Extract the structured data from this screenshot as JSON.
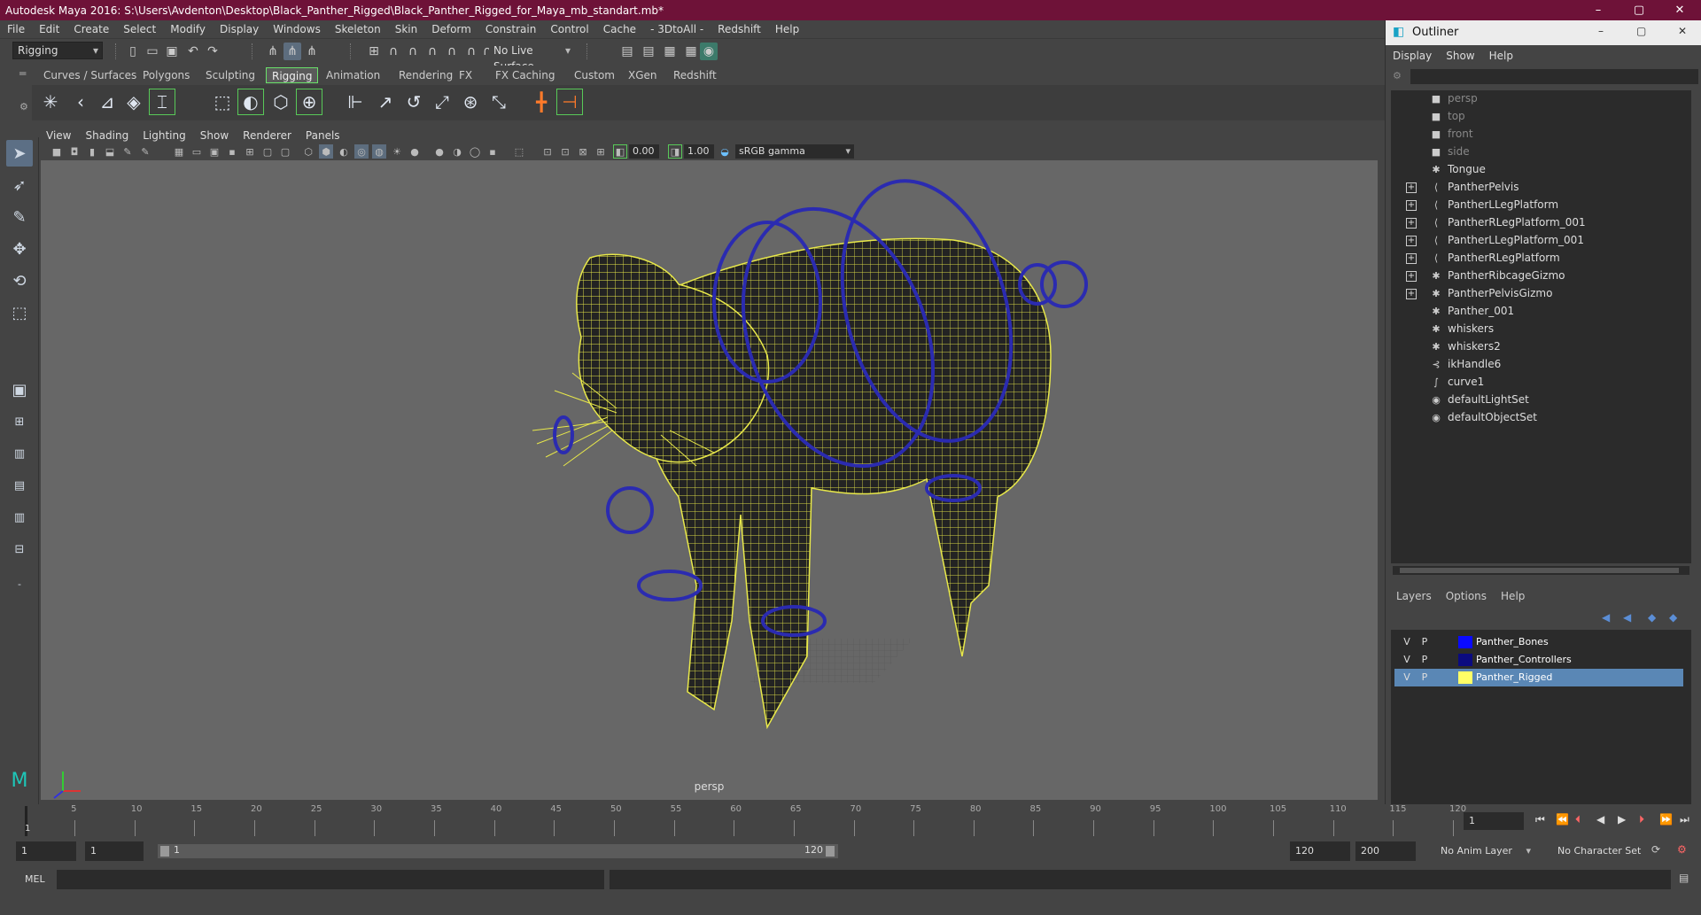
{
  "window": {
    "title": "Autodesk Maya 2016: S:\\Users\\Avdenton\\Desktop\\Black_Panther_Rigged\\Black_Panther_Rigged_for_Maya_mb_standart.mb*",
    "min": "–",
    "max": "▢",
    "close": "✕"
  },
  "menubar": [
    "File",
    "Edit",
    "Create",
    "Select",
    "Modify",
    "Display",
    "Windows",
    "Skeleton",
    "Skin",
    "Deform",
    "Constrain",
    "Control",
    "Cache",
    "- 3DtoAll -",
    "Redshift",
    "Help"
  ],
  "statusline": {
    "menuset": "Rigging",
    "live_surface": "No Live Surface"
  },
  "shelf_tabs": [
    "Curves / Surfaces",
    "Polygons",
    "Sculpting",
    "Rigging",
    "Animation",
    "Rendering",
    "FX",
    "FX Caching",
    "Custom",
    "XGen",
    "Redshift"
  ],
  "shelf_active": "Rigging",
  "viewport": {
    "menu": [
      "View",
      "Shading",
      "Lighting",
      "Show",
      "Renderer",
      "Panels"
    ],
    "exposure": "0.00",
    "gamma": "1.00",
    "colorspace": "sRGB gamma",
    "camera_label": "persp"
  },
  "outliner": {
    "title": "Outliner",
    "menu": [
      "Display",
      "Show",
      "Help"
    ],
    "items": [
      {
        "label": "persp",
        "icon": "camera-icon",
        "expandable": false,
        "dim": true
      },
      {
        "label": "top",
        "icon": "camera-icon",
        "expandable": false,
        "dim": true
      },
      {
        "label": "front",
        "icon": "camera-icon",
        "expandable": false,
        "dim": true
      },
      {
        "label": "side",
        "icon": "camera-icon",
        "expandable": false,
        "dim": true
      },
      {
        "label": "Tongue",
        "icon": "mesh-icon",
        "expandable": false,
        "dim": false
      },
      {
        "label": "PantherPelvis",
        "icon": "joint-icon",
        "expandable": true,
        "dim": false
      },
      {
        "label": "PantherLLegPlatform",
        "icon": "joint-icon",
        "expandable": true,
        "dim": false
      },
      {
        "label": "PantherRLegPlatform_001",
        "icon": "joint-icon",
        "expandable": true,
        "dim": false
      },
      {
        "label": "PantherLLegPlatform_001",
        "icon": "joint-icon",
        "expandable": true,
        "dim": false
      },
      {
        "label": "PantherRLegPlatform",
        "icon": "joint-icon",
        "expandable": true,
        "dim": false
      },
      {
        "label": "PantherRibcageGizmo",
        "icon": "mesh-icon",
        "expandable": true,
        "dim": false
      },
      {
        "label": "PantherPelvisGizmo",
        "icon": "mesh-icon",
        "expandable": true,
        "dim": false
      },
      {
        "label": "Panther_001",
        "icon": "mesh-icon",
        "expandable": false,
        "dim": false
      },
      {
        "label": "whiskers",
        "icon": "mesh-icon",
        "expandable": false,
        "dim": false
      },
      {
        "label": "whiskers2",
        "icon": "mesh-icon",
        "expandable": false,
        "dim": false
      },
      {
        "label": "ikHandle6",
        "icon": "ik-handle-icon",
        "expandable": false,
        "dim": false
      },
      {
        "label": "curve1",
        "icon": "curve-icon",
        "expandable": false,
        "dim": false
      },
      {
        "label": "defaultLightSet",
        "icon": "set-icon",
        "expandable": false,
        "dim": false
      },
      {
        "label": "defaultObjectSet",
        "icon": "set-icon",
        "expandable": false,
        "dim": false
      }
    ]
  },
  "layers": {
    "menu": [
      "Layers",
      "Options",
      "Help"
    ],
    "rows": [
      {
        "v": "V",
        "p": "P",
        "name": "Panther_Bones",
        "color": "#0a0aff",
        "selected": false
      },
      {
        "v": "V",
        "p": "P",
        "name": "Panther_Controllers",
        "color": "#0b0b80",
        "selected": false
      },
      {
        "v": "V",
        "p": "P",
        "name": "Panther_Rigged",
        "color": "#ffff66",
        "selected": true
      }
    ]
  },
  "timeline": {
    "ticks": [
      "5",
      "10",
      "15",
      "20",
      "25",
      "30",
      "35",
      "40",
      "45",
      "50",
      "55",
      "60",
      "65",
      "70",
      "75",
      "80",
      "85",
      "90",
      "95",
      "100",
      "105",
      "110",
      "115",
      "120"
    ],
    "start_tick": "1",
    "current_frame": "1"
  },
  "range": {
    "start": "1",
    "playback_start": "1",
    "slider_start": "1",
    "slider_end": "120",
    "playback_end": "120",
    "end": "200",
    "anim_layer": "No Anim Layer",
    "character_set": "No Character Set"
  },
  "cmdline": {
    "label": "MEL"
  }
}
